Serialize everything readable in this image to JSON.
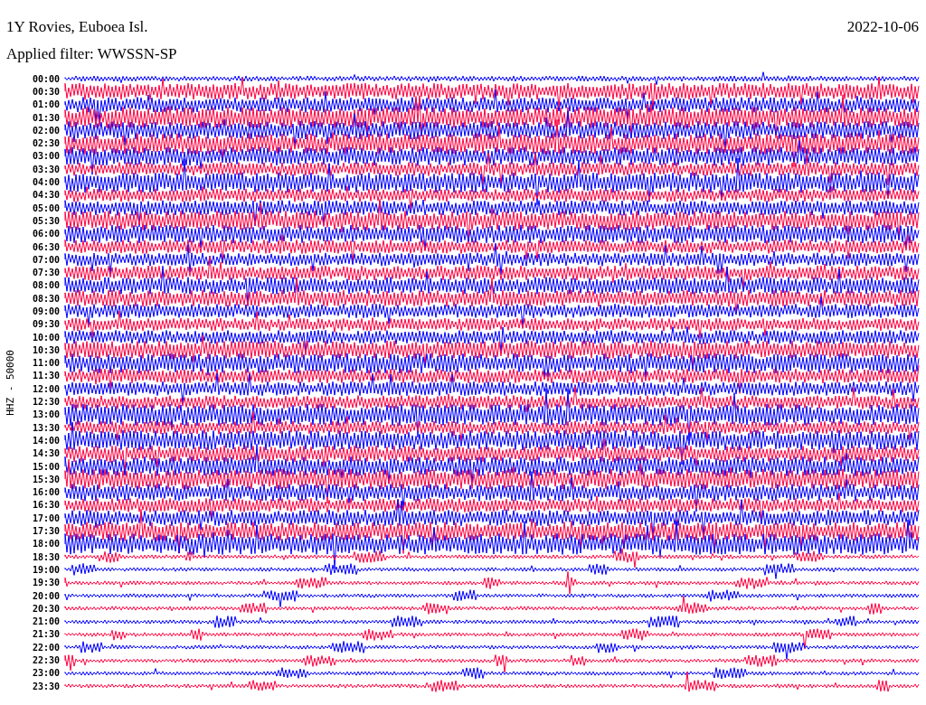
{
  "header": {
    "station": "1Y Rovies, Euboea Isl.",
    "date": "2022-10-06",
    "filter": "Applied filter: WWSSN-SP"
  },
  "axis_label": "HHZ - 50000",
  "traces": [
    {
      "time": "00:00",
      "color": "#0000ff"
    },
    {
      "time": "00:30",
      "color": "#ff0040"
    },
    {
      "time": "01:00",
      "color": "#0000ff"
    },
    {
      "time": "01:30",
      "color": "#ff0040"
    },
    {
      "time": "02:00",
      "color": "#0000ff"
    },
    {
      "time": "02:30",
      "color": "#ff0040"
    },
    {
      "time": "03:00",
      "color": "#0000ff"
    },
    {
      "time": "03:30",
      "color": "#ff0040"
    },
    {
      "time": "04:00",
      "color": "#0000ff"
    },
    {
      "time": "04:30",
      "color": "#ff0040"
    },
    {
      "time": "05:00",
      "color": "#0000ff"
    },
    {
      "time": "05:30",
      "color": "#ff0040"
    },
    {
      "time": "06:00",
      "color": "#0000ff"
    },
    {
      "time": "06:30",
      "color": "#ff0040"
    },
    {
      "time": "07:00",
      "color": "#0000ff"
    },
    {
      "time": "07:30",
      "color": "#ff0040"
    },
    {
      "time": "08:00",
      "color": "#0000ff"
    },
    {
      "time": "08:30",
      "color": "#ff0040"
    },
    {
      "time": "09:00",
      "color": "#0000ff"
    },
    {
      "time": "09:30",
      "color": "#ff0040"
    },
    {
      "time": "10:00",
      "color": "#0000ff"
    },
    {
      "time": "10:30",
      "color": "#ff0040"
    },
    {
      "time": "11:00",
      "color": "#0000ff"
    },
    {
      "time": "11:30",
      "color": "#ff0040"
    },
    {
      "time": "12:00",
      "color": "#0000ff"
    },
    {
      "time": "12:30",
      "color": "#ff0040"
    },
    {
      "time": "13:00",
      "color": "#0000ff"
    },
    {
      "time": "13:30",
      "color": "#ff0040"
    },
    {
      "time": "14:00",
      "color": "#0000ff"
    },
    {
      "time": "14:30",
      "color": "#ff0040"
    },
    {
      "time": "15:00",
      "color": "#0000ff"
    },
    {
      "time": "15:30",
      "color": "#ff0040"
    },
    {
      "time": "16:00",
      "color": "#0000ff"
    },
    {
      "time": "16:30",
      "color": "#ff0040"
    },
    {
      "time": "17:00",
      "color": "#0000ff"
    },
    {
      "time": "17:30",
      "color": "#ff0040"
    },
    {
      "time": "18:00",
      "color": "#0000ff"
    },
    {
      "time": "18:30",
      "color": "#ff0040"
    },
    {
      "time": "19:00",
      "color": "#0000ff"
    },
    {
      "time": "19:30",
      "color": "#ff0040"
    },
    {
      "time": "20:00",
      "color": "#0000ff"
    },
    {
      "time": "20:30",
      "color": "#ff0040"
    },
    {
      "time": "21:00",
      "color": "#0000ff"
    },
    {
      "time": "21:30",
      "color": "#ff0040"
    },
    {
      "time": "22:00",
      "color": "#0000ff"
    },
    {
      "time": "22:30",
      "color": "#ff0040"
    },
    {
      "time": "23:00",
      "color": "#0000ff"
    },
    {
      "time": "23:30",
      "color": "#ff0040"
    }
  ]
}
